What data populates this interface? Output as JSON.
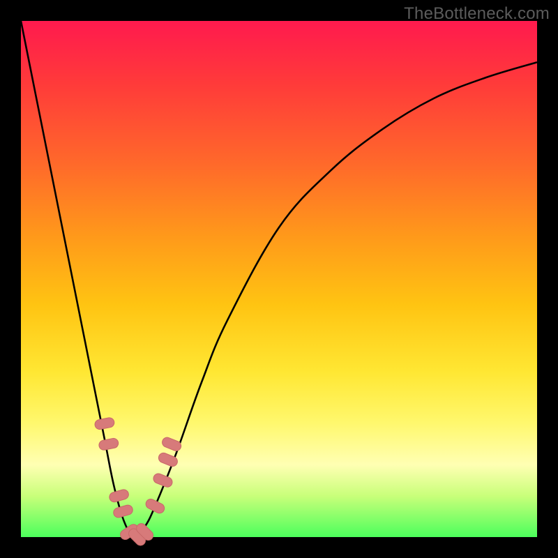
{
  "watermark": "TheBottleneck.com",
  "colors": {
    "frame": "#000000",
    "curve": "#000000",
    "marker_fill": "#d77a7a",
    "marker_stroke": "#c86868"
  },
  "chart_data": {
    "type": "line",
    "title": "",
    "xlabel": "",
    "ylabel": "",
    "xlim": [
      0,
      100
    ],
    "ylim": [
      0,
      100
    ],
    "note": "Axes unlabeled; shape of curve implies bottleneck % (y) vs component-ratio (x). Values are estimated from pixels.",
    "series": [
      {
        "name": "bottleneck-curve",
        "x": [
          0,
          4,
          8,
          12,
          16,
          18,
          20,
          22,
          24,
          26,
          30,
          35,
          40,
          50,
          60,
          70,
          80,
          90,
          100
        ],
        "y": [
          100,
          80,
          60,
          40,
          20,
          10,
          3,
          0,
          2,
          6,
          16,
          30,
          42,
          60,
          71,
          79,
          85,
          89,
          92
        ]
      }
    ],
    "markers": {
      "name": "highlighted-points",
      "note": "Salmon capsule markers near the valley of the curve",
      "x": [
        16.2,
        17.0,
        19.0,
        19.8,
        21.0,
        22.5,
        24.0,
        26.0,
        27.5,
        28.5,
        29.2
      ],
      "y": [
        22,
        18,
        8,
        5,
        1,
        0,
        1,
        6,
        11,
        15,
        18
      ]
    }
  }
}
